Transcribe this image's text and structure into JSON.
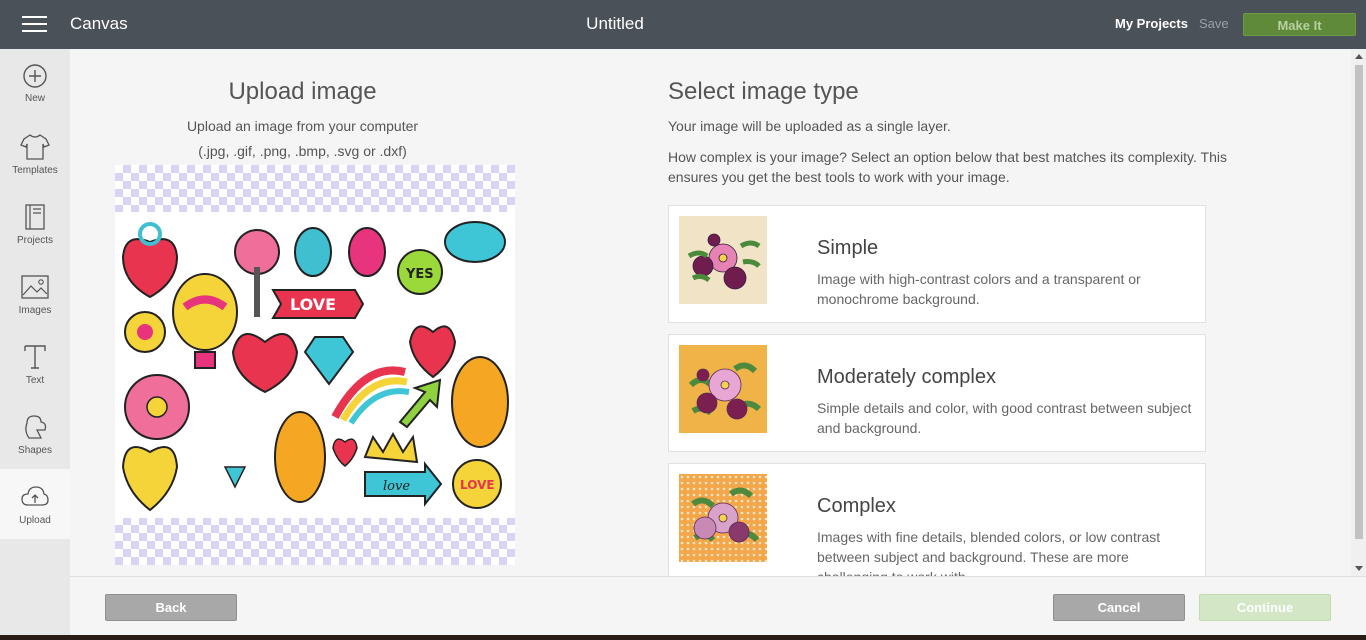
{
  "header": {
    "app_title": "Canvas",
    "doc_title": "Untitled",
    "my_projects": "My Projects",
    "save": "Save",
    "make_it": "Make It"
  },
  "sidebar": {
    "items": [
      {
        "label": "New",
        "icon": "plus-circle-icon"
      },
      {
        "label": "Templates",
        "icon": "shirt-icon"
      },
      {
        "label": "Projects",
        "icon": "book-icon"
      },
      {
        "label": "Images",
        "icon": "image-icon"
      },
      {
        "label": "Text",
        "icon": "text-icon"
      },
      {
        "label": "Shapes",
        "icon": "shapes-icon"
      },
      {
        "label": "Upload",
        "icon": "upload-cloud-icon",
        "active": true
      }
    ]
  },
  "upload": {
    "title": "Upload image",
    "subtitle": "Upload an image from your computer",
    "types": "(.jpg, .gif, .png, .bmp, .svg or .dxf)"
  },
  "image_type": {
    "title": "Select image type",
    "sub1": "Your image will be uploaded as a single layer.",
    "sub2": "How complex is your image? Select an option below that best matches its complexity. This ensures you get the best tools to work with your image.",
    "options": [
      {
        "title": "Simple",
        "desc": "Image with high-contrast colors and a transparent or monochrome background."
      },
      {
        "title": "Moderately complex",
        "desc": "Simple details and color, with good contrast between subject and background."
      },
      {
        "title": "Complex",
        "desc": "Images with fine details, blended colors, or low contrast between subject and background. These are more challenging to work with."
      }
    ]
  },
  "footer": {
    "back": "Back",
    "cancel": "Cancel",
    "continue": "Continue"
  },
  "colors": {
    "topbar": "#4a5159",
    "make_it": "#5f8a3a",
    "continue_disabled": "#d3e6c5",
    "checker": "#d7d5f3"
  }
}
